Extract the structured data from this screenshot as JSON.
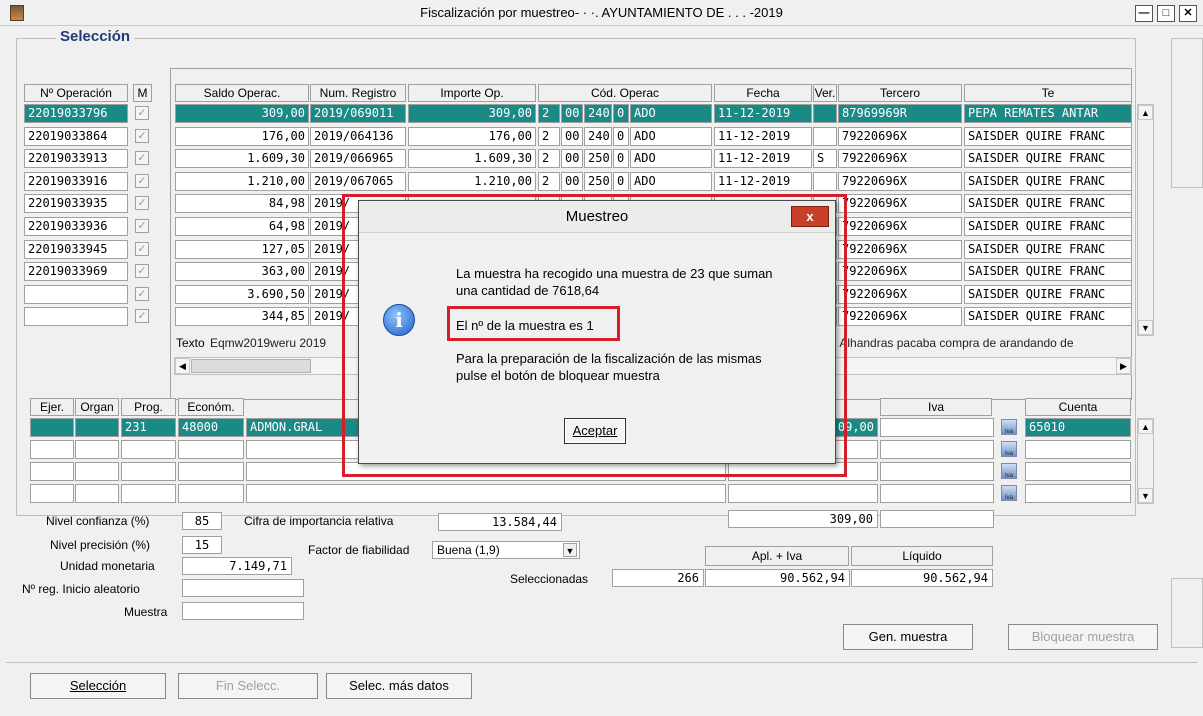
{
  "window": {
    "title": "Fiscalización por muestreo- · ·. AYUNTAMIENTO DE .   . . -2019"
  },
  "group_label": "Selección",
  "top_headers": {
    "op": "Nº Operación",
    "m": "M",
    "saldo": "Saldo Operac.",
    "num_reg": "Num. Registro",
    "importe": "Importe Op.",
    "cod": "Cód. Operac",
    "fecha": "Fecha",
    "ver": "Ver.",
    "tercero": "Tercero",
    "te": "Te"
  },
  "left_ops": [
    "22019033796",
    "22019033864",
    "22019033913",
    "22019033916",
    "22019033935",
    "22019033936",
    "22019033945",
    "22019033969",
    "",
    ""
  ],
  "rows": [
    {
      "saldo": "309,00",
      "reg": "2019/069011",
      "imp": "309,00",
      "c1": "2",
      "c2": "00",
      "c3": "240",
      "c4": "0",
      "c5": "ADO",
      "fecha": "11-12-2019",
      "ver": "",
      "ter": "87969969R",
      "te": "PEPA REMATES ANTAR"
    },
    {
      "saldo": "176,00",
      "reg": "2019/064136",
      "imp": "176,00",
      "c1": "2",
      "c2": "00",
      "c3": "240",
      "c4": "0",
      "c5": "ADO",
      "fecha": "11-12-2019",
      "ver": "",
      "ter": "79220696X",
      "te": "SAISDER QUIRE FRANC"
    },
    {
      "saldo": "1.609,30",
      "reg": "2019/066965",
      "imp": "1.609,30",
      "c1": "2",
      "c2": "00",
      "c3": "250",
      "c4": "0",
      "c5": "ADO",
      "fecha": "11-12-2019",
      "ver": "S",
      "ter": "79220696X",
      "te": "SAISDER QUIRE FRANC"
    },
    {
      "saldo": "1.210,00",
      "reg": "2019/067065",
      "imp": "1.210,00",
      "c1": "2",
      "c2": "00",
      "c3": "250",
      "c4": "0",
      "c5": "ADO",
      "fecha": "11-12-2019",
      "ver": "",
      "ter": "79220696X",
      "te": "SAISDER QUIRE FRANC"
    },
    {
      "saldo": "84,98",
      "reg": "2019/",
      "imp": "",
      "c1": "",
      "c2": "",
      "c3": "",
      "c4": "",
      "c5": "",
      "fecha": "",
      "ver": "",
      "ter": "79220696X",
      "te": "SAISDER QUIRE FRANC"
    },
    {
      "saldo": "64,98",
      "reg": "2019/",
      "imp": "",
      "c1": "",
      "c2": "",
      "c3": "",
      "c4": "",
      "c5": "",
      "fecha": "",
      "ver": "",
      "ter": "79220696X",
      "te": "SAISDER QUIRE FRANC"
    },
    {
      "saldo": "127,05",
      "reg": "2019/",
      "imp": "",
      "c1": "",
      "c2": "",
      "c3": "",
      "c4": "",
      "c5": "",
      "fecha": "",
      "ver": "",
      "ter": "79220696X",
      "te": "SAISDER QUIRE FRANC"
    },
    {
      "saldo": "363,00",
      "reg": "2019/",
      "imp": "",
      "c1": "",
      "c2": "",
      "c3": "",
      "c4": "",
      "c5": "",
      "fecha": "",
      "ver": "",
      "ter": "79220696X",
      "te": "SAISDER QUIRE FRANC"
    },
    {
      "saldo": "3.690,50",
      "reg": "2019/",
      "imp": "",
      "c1": "",
      "c2": "",
      "c3": "",
      "c4": "",
      "c5": "",
      "fecha": "",
      "ver": "",
      "ter": "79220696X",
      "te": "SAISDER QUIRE FRANC"
    },
    {
      "saldo": "344,85",
      "reg": "2019/",
      "imp": "",
      "c1": "",
      "c2": "",
      "c3": "",
      "c4": "",
      "c5": "",
      "fecha": "",
      "ver": "",
      "ter": "79220696X",
      "te": "SAISDER QUIRE FRANC"
    }
  ],
  "texto_label": "Texto",
  "texto_value": "Eqmw2019weru 2019",
  "texto_right": "e Alhandras pacaba compra de arandando de",
  "bottom_headers": {
    "ejer": "Ejer.",
    "organ": "Organ",
    "prog": "Prog.",
    "econ": "Económ.",
    "iva": "Iva",
    "cuenta": "Cuenta"
  },
  "bottom_row": {
    "prog": "231",
    "econ": "48000",
    "desc": "ADMON.GRAL",
    "imp": "09,00",
    "cuenta": "65010"
  },
  "iva_icon_label": "Iva",
  "total_309": "309,00",
  "params": {
    "nivel_confianza_label": "Nivel confianza (%)",
    "nivel_confianza": "85",
    "nivel_precision_label": "Nivel precisión (%)",
    "nivel_precision": "15",
    "unidad_monetaria_label": "Unidad monetaria",
    "unidad_monetaria": "7.149,71",
    "reg_inicio_label": "Nº reg. Inicio aleatorio",
    "reg_inicio": "",
    "muestra_label": "Muestra",
    "muestra": "",
    "cifra_label": "Cifra de importancia relativa",
    "cifra": "13.584,44",
    "factor_label": "Factor de fiabilidad",
    "factor": "Buena (1,9)",
    "seleccionadas_label": "Seleccionadas",
    "seleccionadas": "266",
    "apl_iva_label": "Apl. + Iva",
    "apl_iva": "90.562,94",
    "liquido_label": "Líquido",
    "liquido": "90.562,94"
  },
  "buttons": {
    "gen_muestra": "Gen. muestra",
    "bloquear": "Bloquear muestra",
    "seleccion": "Selección",
    "fin_selecc": "Fin Selecc.",
    "selec_mas": "Selec. más datos"
  },
  "dialog": {
    "title": "Muestreo",
    "close": "x",
    "line1": "La muestra ha recogido una muestra de 23 que suman",
    "line2": "una cantidad de 7618,64",
    "line3": "El nº de la muestra es 1",
    "line4": "Para la preparación de la fiscalización de las mismas",
    "line5": "pulse el botón de bloquear muestra",
    "ok": "Aceptar",
    "icon": "info-icon"
  },
  "colors": {
    "selected_row": "#1a8a87",
    "highlight": "#d41e2a"
  }
}
